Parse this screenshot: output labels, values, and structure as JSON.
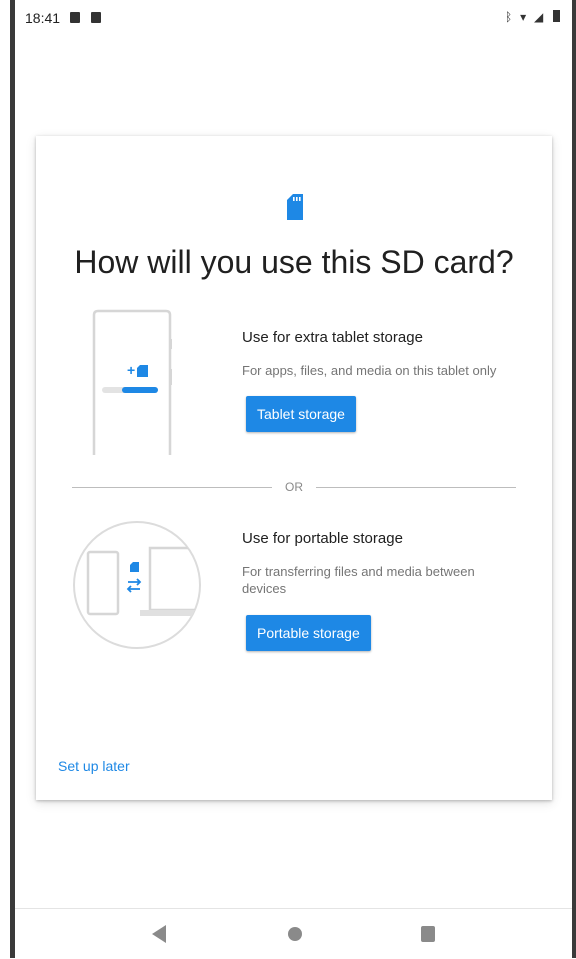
{
  "status_bar": {
    "time": "18:41",
    "right_icons": "bluetooth-icon wifi-icon signal-icon battery-icon"
  },
  "dialog": {
    "title": "How will you use this SD card?",
    "option_tablet": {
      "title": "Use for extra tablet storage",
      "description": "For apps, files, and media on this tablet only",
      "button_label": "Tablet storage"
    },
    "divider_text": "OR",
    "option_portable": {
      "title": "Use for portable storage",
      "description": "For transferring files and media between devices",
      "button_label": "Portable storage"
    },
    "setup_later_label": "Set up later"
  },
  "colors": {
    "accent": "#1e88e5",
    "title_text": "#202020",
    "secondary_text": "#757575",
    "divider": "#bdbdbd"
  },
  "icons": [
    "sd-card-icon",
    "back-icon",
    "home-icon",
    "recents-icon"
  ]
}
